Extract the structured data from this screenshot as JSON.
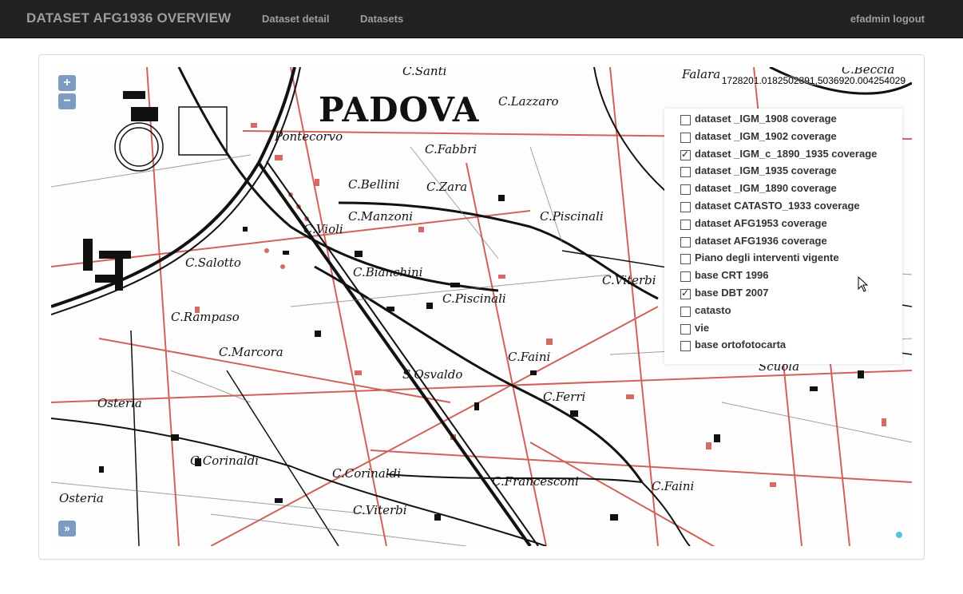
{
  "navbar": {
    "brand": "DATASET AFG1936 OVERVIEW",
    "links": [
      "Dataset detail",
      "Datasets"
    ],
    "user": "efadmin logout"
  },
  "map": {
    "zoom_in": "+",
    "zoom_out": "−",
    "coords": "1728201.0182502391,5036920.004254029",
    "expand": "»",
    "labels": [
      "PADOVA",
      "C.Lazzaro",
      "C.Santi",
      "Falara",
      "C.Beccia",
      "Pontecorvo",
      "C.Fabbri",
      "C.Bellini",
      "C.Zara",
      "C.Manzoni",
      "C.Piscinali",
      "C.Violi",
      "C.Salotto",
      "C.Bianchini",
      "C.Viterbi",
      "C.Piscinali",
      "C.Rampaso",
      "C.Marcora",
      "C.Faini",
      "S.Osvaldo",
      "C.Ferri",
      "Osteria",
      "C.Corinaldi",
      "C.Corinaldi",
      "C.Francesconi",
      "C.Faini",
      "Osteria",
      "C.Viterbi",
      "Scuola"
    ]
  },
  "layers": [
    {
      "label": "dataset _IGM_1908 coverage",
      "checked": false
    },
    {
      "label": "dataset _IGM_1902 coverage",
      "checked": false
    },
    {
      "label": "dataset _IGM_c_1890_1935 coverage",
      "checked": true
    },
    {
      "label": "dataset _IGM_1935 coverage",
      "checked": false
    },
    {
      "label": "dataset _IGM_1890 coverage",
      "checked": false
    },
    {
      "label": "dataset CATASTO_1933 coverage",
      "checked": false
    },
    {
      "label": "dataset AFG1953 coverage",
      "checked": false
    },
    {
      "label": "dataset AFG1936 coverage",
      "checked": false
    },
    {
      "label": "Piano degli interventi vigente",
      "checked": false
    },
    {
      "label": "base CRT 1996",
      "checked": false
    },
    {
      "label": "base DBT 2007",
      "checked": true
    },
    {
      "label": "catasto",
      "checked": false
    },
    {
      "label": "vie",
      "checked": false
    },
    {
      "label": "base ortofotocarta",
      "checked": false
    }
  ],
  "colors": {
    "navbar": "#222222",
    "red_overlay": "#c9473f",
    "control": "#003c88"
  }
}
